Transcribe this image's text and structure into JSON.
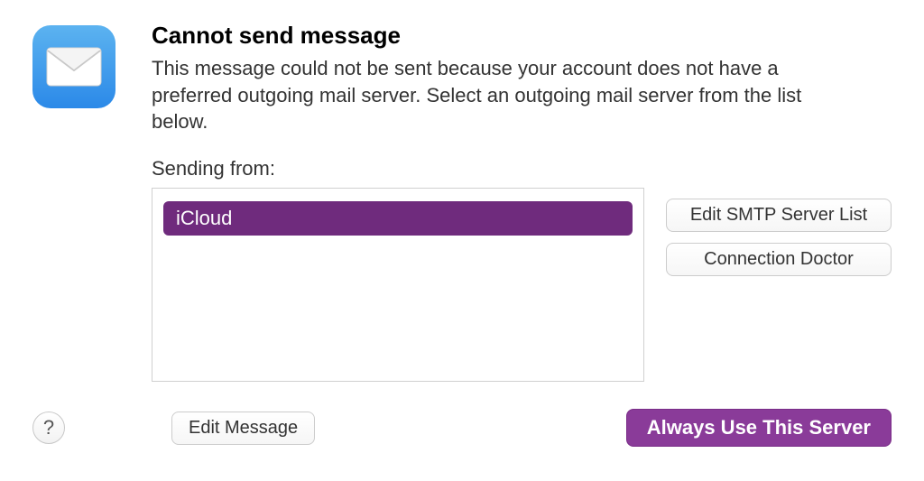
{
  "dialog": {
    "title": "Cannot send message",
    "description": "This message could not be sent because your account does not have a preferred outgoing mail server. Select an outgoing mail server from the list below.",
    "sending_from_label": "Sending from:",
    "servers": [
      {
        "name": "iCloud",
        "selected": true
      }
    ],
    "buttons": {
      "edit_smtp": "Edit SMTP Server List",
      "connection_doctor": "Connection Doctor",
      "edit_message": "Edit Message",
      "always_use": "Always Use This Server",
      "help": "?"
    }
  },
  "colors": {
    "accent": "#6f2b7d",
    "primary_button": "#8a3b99"
  },
  "icons": {
    "mail": "mail-icon"
  }
}
